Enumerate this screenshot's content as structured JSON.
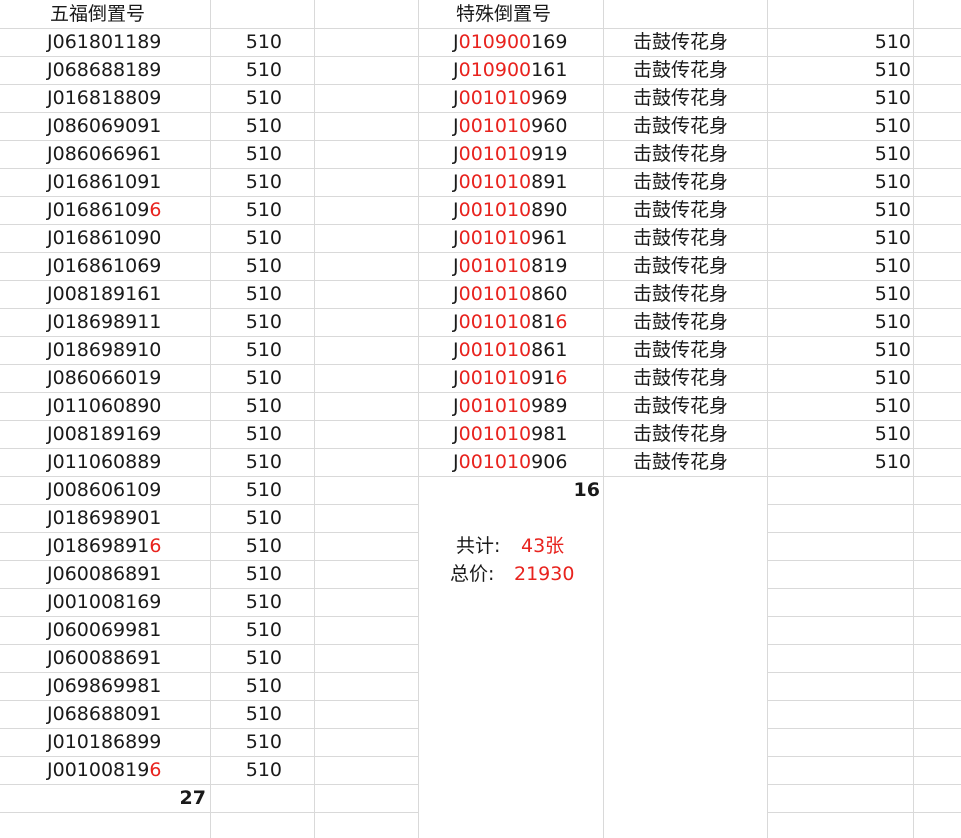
{
  "left_section": {
    "header": "五福倒置号",
    "rows": [
      {
        "code": [
          "J061801189"
        ],
        "amount": "510"
      },
      {
        "code": [
          "J068688189"
        ],
        "amount": "510"
      },
      {
        "code": [
          "J016818809"
        ],
        "amount": "510"
      },
      {
        "code": [
          "J086069091"
        ],
        "amount": "510"
      },
      {
        "code": [
          "J086066961"
        ],
        "amount": "510"
      },
      {
        "code": [
          "J016861091"
        ],
        "amount": "510"
      },
      {
        "code": [
          "J01686109",
          "6"
        ],
        "amount": "510"
      },
      {
        "code": [
          "J016861090"
        ],
        "amount": "510"
      },
      {
        "code": [
          "J016861069"
        ],
        "amount": "510"
      },
      {
        "code": [
          "J008189161"
        ],
        "amount": "510"
      },
      {
        "code": [
          "J018698911"
        ],
        "amount": "510"
      },
      {
        "code": [
          "J018698910"
        ],
        "amount": "510"
      },
      {
        "code": [
          "J086066019"
        ],
        "amount": "510"
      },
      {
        "code": [
          "J011060890"
        ],
        "amount": "510"
      },
      {
        "code": [
          "J008189169"
        ],
        "amount": "510"
      },
      {
        "code": [
          "J011060889"
        ],
        "amount": "510"
      },
      {
        "code": [
          "J008606109"
        ],
        "amount": "510"
      },
      {
        "code": [
          "J018698901"
        ],
        "amount": "510"
      },
      {
        "code": [
          "J01869891",
          "6"
        ],
        "amount": "510"
      },
      {
        "code": [
          "J060086891"
        ],
        "amount": "510"
      },
      {
        "code": [
          "J001008169"
        ],
        "amount": "510"
      },
      {
        "code": [
          "J060069981"
        ],
        "amount": "510"
      },
      {
        "code": [
          "J060088691"
        ],
        "amount": "510"
      },
      {
        "code": [
          "J069869981"
        ],
        "amount": "510"
      },
      {
        "code": [
          "J068688091"
        ],
        "amount": "510"
      },
      {
        "code": [
          "J010186899"
        ],
        "amount": "510"
      },
      {
        "code": [
          "J00100819",
          "6"
        ],
        "amount": "510"
      }
    ],
    "count": "27"
  },
  "right_section": {
    "header": "特殊倒置号",
    "rows": [
      {
        "code": [
          "J",
          "010900",
          "169"
        ],
        "name": "击鼓传花身",
        "amount": "510"
      },
      {
        "code": [
          "J",
          "010900",
          "161"
        ],
        "name": "击鼓传花身",
        "amount": "510"
      },
      {
        "code": [
          "J",
          "001010",
          "969"
        ],
        "name": "击鼓传花身",
        "amount": "510"
      },
      {
        "code": [
          "J",
          "001010",
          "960"
        ],
        "name": "击鼓传花身",
        "amount": "510"
      },
      {
        "code": [
          "J",
          "001010",
          "919"
        ],
        "name": "击鼓传花身",
        "amount": "510"
      },
      {
        "code": [
          "J",
          "001010",
          "891"
        ],
        "name": "击鼓传花身",
        "amount": "510"
      },
      {
        "code": [
          "J",
          "001010",
          "890"
        ],
        "name": "击鼓传花身",
        "amount": "510"
      },
      {
        "code": [
          "J",
          "001010",
          "961"
        ],
        "name": "击鼓传花身",
        "amount": "510"
      },
      {
        "code": [
          "J",
          "001010",
          "819"
        ],
        "name": "击鼓传花身",
        "amount": "510"
      },
      {
        "code": [
          "J",
          "001010",
          "860"
        ],
        "name": "击鼓传花身",
        "amount": "510"
      },
      {
        "code": [
          "J",
          "001010",
          "81",
          "6"
        ],
        "name": "击鼓传花身",
        "amount": "510"
      },
      {
        "code": [
          "J",
          "001010",
          "861"
        ],
        "name": "击鼓传花身",
        "amount": "510"
      },
      {
        "code": [
          "J",
          "001010",
          "91",
          "6"
        ],
        "name": "击鼓传花身",
        "amount": "510"
      },
      {
        "code": [
          "J",
          "001010",
          "989"
        ],
        "name": "击鼓传花身",
        "amount": "510"
      },
      {
        "code": [
          "J",
          "001010",
          "981"
        ],
        "name": "击鼓传花身",
        "amount": "510"
      },
      {
        "code": [
          "J",
          "001010",
          "906"
        ],
        "name": "击鼓传花身",
        "amount": "510"
      }
    ],
    "count": "16"
  },
  "summary": {
    "total_label": "共计:",
    "total_value": "43张",
    "price_label": "总价:",
    "price_value": "21930"
  },
  "colors": {
    "highlight": "#e8231e",
    "grid": "#d9d9d9"
  }
}
